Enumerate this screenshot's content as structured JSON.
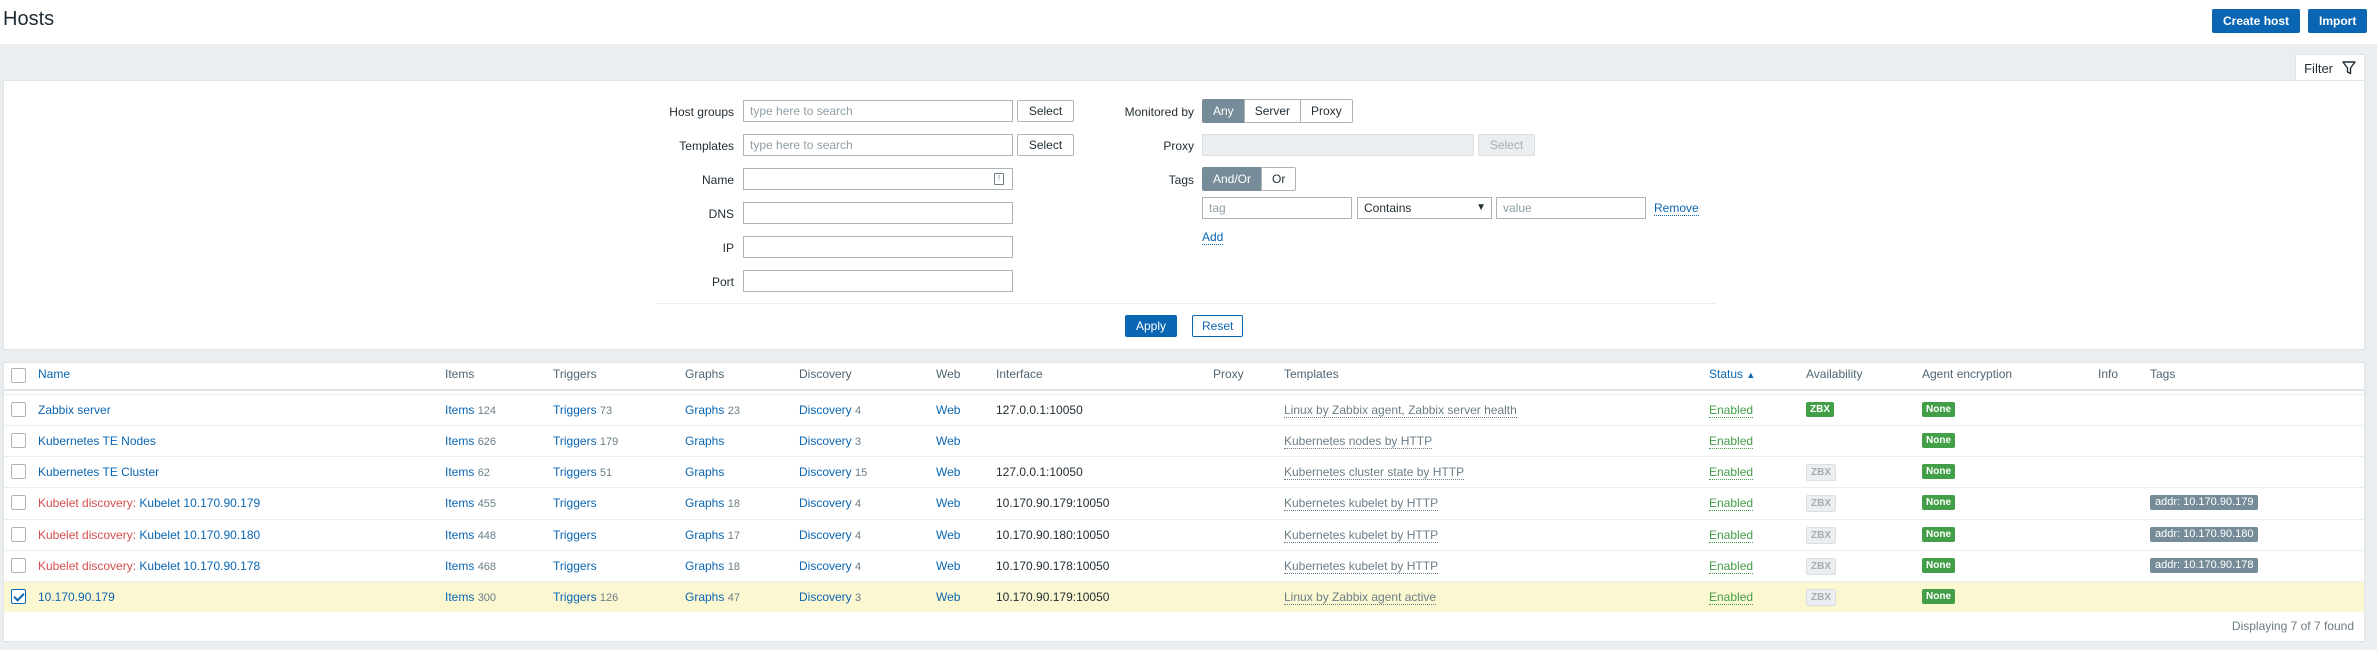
{
  "header": {
    "title": "Hosts",
    "create_host": "Create host",
    "import": "Import"
  },
  "filter": {
    "tab_label": "Filter",
    "host_groups_label": "Host groups",
    "host_groups_placeholder": "type here to search",
    "templates_label": "Templates",
    "templates_placeholder": "type here to search",
    "select_label": "Select",
    "name_label": "Name",
    "dns_label": "DNS",
    "ip_label": "IP",
    "port_label": "Port",
    "monitored_by_label": "Monitored by",
    "monitored_by_options": [
      "Any",
      "Server",
      "Proxy"
    ],
    "proxy_label": "Proxy",
    "tags_label": "Tags",
    "tags_options": [
      "And/Or",
      "Or"
    ],
    "tag_placeholder": "tag",
    "operator_value": "Contains",
    "value_placeholder": "value",
    "remove_label": "Remove",
    "add_label": "Add",
    "apply_label": "Apply",
    "reset_label": "Reset"
  },
  "table": {
    "columns": {
      "name": "Name",
      "items": "Items",
      "triggers": "Triggers",
      "graphs": "Graphs",
      "discovery": "Discovery",
      "web": "Web",
      "interface": "Interface",
      "proxy": "Proxy",
      "templates": "Templates",
      "status": "Status",
      "availability": "Availability",
      "agent_encryption": "Agent encryption",
      "info": "Info",
      "tags": "Tags"
    },
    "sort_arrow": "▲",
    "rows": [
      {
        "prefix": "",
        "name": "Zabbix server",
        "items": "Items",
        "items_count": "124",
        "triggers": "Triggers",
        "triggers_count": "73",
        "graphs": "Graphs",
        "graphs_count": "23",
        "discovery": "Discovery",
        "discovery_count": "4",
        "web": "Web",
        "interface": "127.0.0.1:10050",
        "templates": "Linux by Zabbix agent, Zabbix server health",
        "status": "Enabled",
        "availability": "ZBX",
        "availability_active": true,
        "encryption": "None",
        "tag": "",
        "checked": false
      },
      {
        "prefix": "",
        "name": "Kubernetes TE Nodes",
        "items": "Items",
        "items_count": "626",
        "triggers": "Triggers",
        "triggers_count": "179",
        "graphs": "Graphs",
        "graphs_count": "",
        "discovery": "Discovery",
        "discovery_count": "3",
        "web": "Web",
        "interface": "",
        "templates": "Kubernetes nodes by HTTP",
        "status": "Enabled",
        "availability": "",
        "availability_active": false,
        "encryption": "None",
        "tag": "",
        "checked": false
      },
      {
        "prefix": "",
        "name": "Kubernetes TE Cluster",
        "items": "Items",
        "items_count": "62",
        "triggers": "Triggers",
        "triggers_count": "51",
        "graphs": "Graphs",
        "graphs_count": "",
        "discovery": "Discovery",
        "discovery_count": "15",
        "web": "Web",
        "interface": "127.0.0.1:10050",
        "templates": "Kubernetes cluster state by HTTP",
        "status": "Enabled",
        "availability": "ZBX",
        "availability_active": false,
        "encryption": "None",
        "tag": "",
        "checked": false
      },
      {
        "prefix": "Kubelet discovery",
        "name": "Kubelet 10.170.90.179",
        "items": "Items",
        "items_count": "455",
        "triggers": "Triggers",
        "triggers_count": "",
        "graphs": "Graphs",
        "graphs_count": "18",
        "discovery": "Discovery",
        "discovery_count": "4",
        "web": "Web",
        "interface": "10.170.90.179:10050",
        "templates": "Kubernetes kubelet by HTTP",
        "status": "Enabled",
        "availability": "ZBX",
        "availability_active": false,
        "encryption": "None",
        "tag": "addr: 10.170.90.179",
        "checked": false
      },
      {
        "prefix": "Kubelet discovery",
        "name": "Kubelet 10.170.90.180",
        "items": "Items",
        "items_count": "448",
        "triggers": "Triggers",
        "triggers_count": "",
        "graphs": "Graphs",
        "graphs_count": "17",
        "discovery": "Discovery",
        "discovery_count": "4",
        "web": "Web",
        "interface": "10.170.90.180:10050",
        "templates": "Kubernetes kubelet by HTTP",
        "status": "Enabled",
        "availability": "ZBX",
        "availability_active": false,
        "encryption": "None",
        "tag": "addr: 10.170.90.180",
        "checked": false
      },
      {
        "prefix": "Kubelet discovery",
        "name": "Kubelet 10.170.90.178",
        "items": "Items",
        "items_count": "468",
        "triggers": "Triggers",
        "triggers_count": "",
        "graphs": "Graphs",
        "graphs_count": "18",
        "discovery": "Discovery",
        "discovery_count": "4",
        "web": "Web",
        "interface": "10.170.90.178:10050",
        "templates": "Kubernetes kubelet by HTTP",
        "status": "Enabled",
        "availability": "ZBX",
        "availability_active": false,
        "encryption": "None",
        "tag": "addr: 10.170.90.178",
        "checked": false
      },
      {
        "prefix": "",
        "name": "10.170.90.179",
        "items": "Items",
        "items_count": "300",
        "triggers": "Triggers",
        "triggers_count": "126",
        "graphs": "Graphs",
        "graphs_count": "47",
        "discovery": "Discovery",
        "discovery_count": "3",
        "web": "Web",
        "interface": "10.170.90.179:10050",
        "templates": "Linux by Zabbix agent active",
        "status": "Enabled",
        "availability": "ZBX",
        "availability_active": false,
        "encryption": "None",
        "tag": "",
        "checked": true
      }
    ],
    "footer": "Displaying 7 of 7 found"
  },
  "colors": {
    "primary": "#0a66b3",
    "enabled": "#429e47",
    "discovery_prefix": "#d64e4e",
    "selected_row": "#fbf7d0"
  }
}
